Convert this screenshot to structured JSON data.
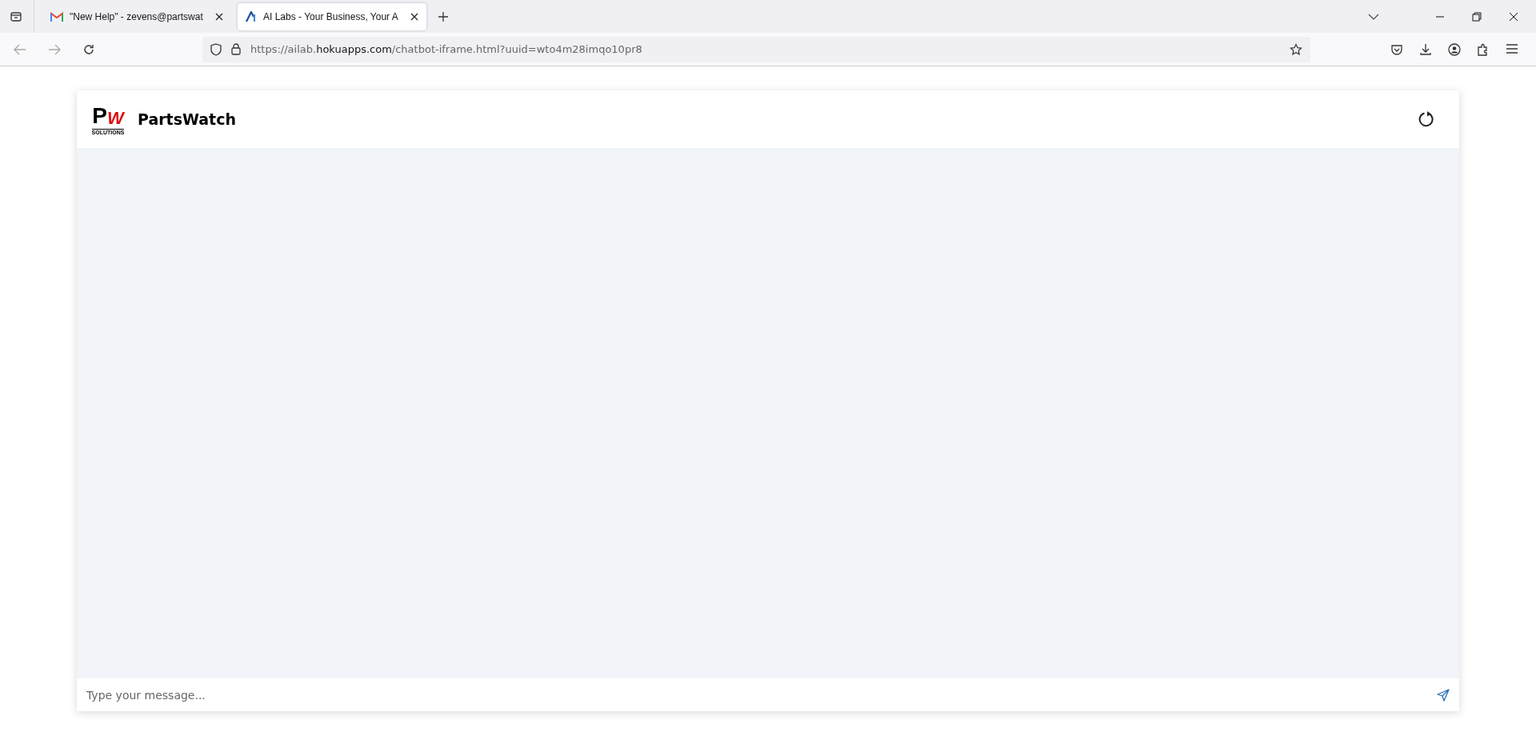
{
  "browser": {
    "tabs": [
      {
        "title": "\"New Help\" - zevens@partswat",
        "kind": "mail",
        "selected": false
      },
      {
        "title": "AI Labs - Your Business, Your A",
        "kind": "ai",
        "selected": true
      }
    ],
    "url": {
      "prefix": "https://ailab.",
      "domain": "hokuapps.com",
      "path": "/chatbot-iframe.html?uuid=wto4m28imqo10pr8"
    }
  },
  "chat": {
    "logo": {
      "letter_1": "P",
      "letter_2": "W",
      "tagline": "SOLUTIONS"
    },
    "title": "PartsWatch",
    "input": {
      "placeholder": "Type your message..."
    }
  }
}
